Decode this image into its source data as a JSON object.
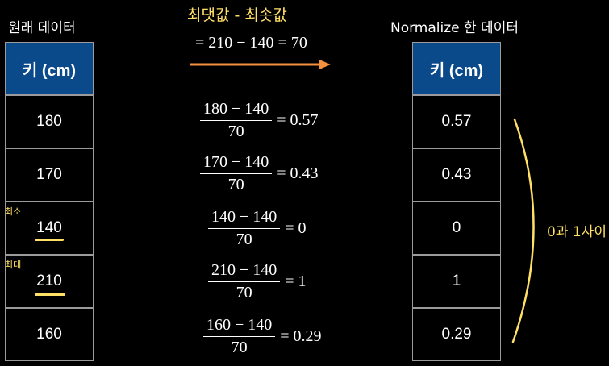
{
  "left_title": "원래 데이터",
  "right_title": "Normalize 한 데이터",
  "column_header": "키 (cm)",
  "original_values": [
    "180",
    "170",
    "140",
    "210",
    "160"
  ],
  "normalized_values": [
    "0.57",
    "0.43",
    "0",
    "1",
    "0.29"
  ],
  "min_label": "최소",
  "max_label": "최대",
  "range_label": "최댓값 - 최솟값",
  "range_equation": "= 210 − 140 = 70",
  "range_label_color": "#ffe066",
  "arrow_color": "#f5913e",
  "formulas": [
    {
      "numerator": "180 − 140",
      "denominator": "70",
      "result": "= 0.57"
    },
    {
      "numerator": "170 − 140",
      "denominator": "70",
      "result": "= 0.43"
    },
    {
      "numerator": "140 − 140",
      "denominator": "70",
      "result": "= 0"
    },
    {
      "numerator": "210 − 140",
      "denominator": "70",
      "result": "= 1"
    },
    {
      "numerator": "160 − 140",
      "denominator": "70",
      "result": "= 0.29"
    }
  ],
  "bracket_label": "0과 1사이"
}
